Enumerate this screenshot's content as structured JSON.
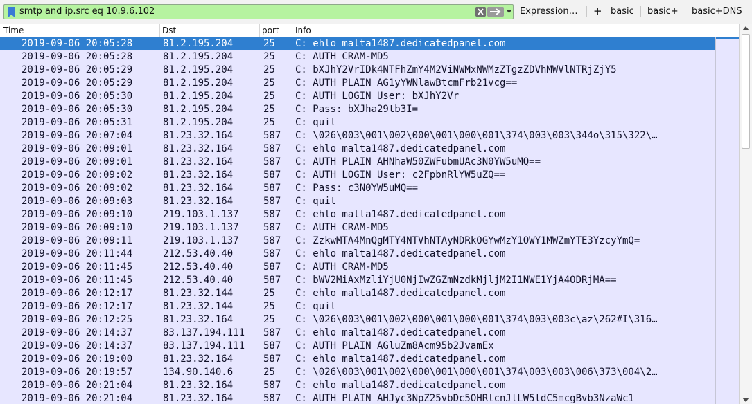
{
  "filter": {
    "value": "smtp and ip.src eq 10.9.6.102",
    "bookmark_icon": "bookmark-icon",
    "clear_icon": "clear-x-icon",
    "apply_icon": "apply-arrow-icon",
    "dropdown_icon": "chevron-down-icon",
    "background_color": "#b6f3a0"
  },
  "toolbar": {
    "expression_label": "Expression…",
    "add_label": "+",
    "buttons": [
      "basic",
      "basic+",
      "basic+DNS"
    ]
  },
  "columns": [
    "Time",
    "Dst",
    "port",
    "Info"
  ],
  "selected_color": "#2f7fd0",
  "row_color": "#e7e6ff",
  "rows": [
    {
      "time": "2019-09-06 20:05:28",
      "dst": "81.2.195.204",
      "port": "25",
      "info": "C: ehlo malta1487.dedicatedpanel.com",
      "selected": true,
      "conv": "start"
    },
    {
      "time": "2019-09-06 20:05:28",
      "dst": "81.2.195.204",
      "port": "25",
      "info": "C: AUTH CRAM-MD5",
      "conv": "mid"
    },
    {
      "time": "2019-09-06 20:05:29",
      "dst": "81.2.195.204",
      "port": "25",
      "info": "C: bXJhY2VrIDk4NTFhZmY4M2ViNWMxNWMzZTgzZDVhMWVlNTRjZjY5",
      "conv": "mid"
    },
    {
      "time": "2019-09-06 20:05:29",
      "dst": "81.2.195.204",
      "port": "25",
      "info": "C: AUTH PLAIN AG1yYWNlawBtcmFrb21vcg==",
      "conv": "mid"
    },
    {
      "time": "2019-09-06 20:05:30",
      "dst": "81.2.195.204",
      "port": "25",
      "info": "C: AUTH LOGIN User: bXJhY2Vr",
      "conv": "mid"
    },
    {
      "time": "2019-09-06 20:05:30",
      "dst": "81.2.195.204",
      "port": "25",
      "info": "C: Pass: bXJha29tb3I=",
      "conv": "mid"
    },
    {
      "time": "2019-09-06 20:05:31",
      "dst": "81.2.195.204",
      "port": "25",
      "info": "C: quit",
      "conv": "end"
    },
    {
      "time": "2019-09-06 20:07:04",
      "dst": "81.23.32.164",
      "port": "587",
      "info": "C: \\026\\003\\001\\002\\000\\001\\000\\001\\374\\003\\003\\344o\\315\\322\\…"
    },
    {
      "time": "2019-09-06 20:09:01",
      "dst": "81.23.32.164",
      "port": "587",
      "info": "C: ehlo malta1487.dedicatedpanel.com"
    },
    {
      "time": "2019-09-06 20:09:01",
      "dst": "81.23.32.164",
      "port": "587",
      "info": "C: AUTH PLAIN AHNhaW50ZWFubmUAc3N0YW5uMQ=="
    },
    {
      "time": "2019-09-06 20:09:02",
      "dst": "81.23.32.164",
      "port": "587",
      "info": "C: AUTH LOGIN User: c2FpbnRlYW5uZQ=="
    },
    {
      "time": "2019-09-06 20:09:02",
      "dst": "81.23.32.164",
      "port": "587",
      "info": "C: Pass: c3N0YW5uMQ=="
    },
    {
      "time": "2019-09-06 20:09:03",
      "dst": "81.23.32.164",
      "port": "587",
      "info": "C: quit"
    },
    {
      "time": "2019-09-06 20:09:10",
      "dst": "219.103.1.137",
      "port": "587",
      "info": "C: ehlo malta1487.dedicatedpanel.com"
    },
    {
      "time": "2019-09-06 20:09:10",
      "dst": "219.103.1.137",
      "port": "587",
      "info": "C: AUTH CRAM-MD5"
    },
    {
      "time": "2019-09-06 20:09:11",
      "dst": "219.103.1.137",
      "port": "587",
      "info": "C: ZzkwMTA4MnQgMTY4NTVhNTAyNDRkOGYwMzY1OWY1MWZmYTE3YzcyYmQ="
    },
    {
      "time": "2019-09-06 20:11:44",
      "dst": "212.53.40.40",
      "port": "587",
      "info": "C: ehlo malta1487.dedicatedpanel.com"
    },
    {
      "time": "2019-09-06 20:11:45",
      "dst": "212.53.40.40",
      "port": "587",
      "info": "C: AUTH CRAM-MD5"
    },
    {
      "time": "2019-09-06 20:11:45",
      "dst": "212.53.40.40",
      "port": "587",
      "info": "C: bWV2MiAxMzliYjU0NjIwZGZmNzdkMjljM2I1NWE1YjA4ODRjMA=="
    },
    {
      "time": "2019-09-06 20:12:17",
      "dst": "81.23.32.144",
      "port": "25",
      "info": "C: ehlo malta1487.dedicatedpanel.com"
    },
    {
      "time": "2019-09-06 20:12:17",
      "dst": "81.23.32.144",
      "port": "25",
      "info": "C: quit"
    },
    {
      "time": "2019-09-06 20:12:25",
      "dst": "81.23.32.164",
      "port": "25",
      "info": "C: \\026\\003\\001\\002\\000\\001\\000\\001\\374\\003\\003c\\az\\262#I\\316…"
    },
    {
      "time": "2019-09-06 20:14:37",
      "dst": "83.137.194.111",
      "port": "587",
      "info": "C: ehlo malta1487.dedicatedpanel.com"
    },
    {
      "time": "2019-09-06 20:14:37",
      "dst": "83.137.194.111",
      "port": "587",
      "info": "C: AUTH PLAIN AGluZm8Acm95b2JvamEx"
    },
    {
      "time": "2019-09-06 20:19:00",
      "dst": "81.23.32.164",
      "port": "587",
      "info": "C: ehlo malta1487.dedicatedpanel.com"
    },
    {
      "time": "2019-09-06 20:19:57",
      "dst": "134.90.140.6",
      "port": "25",
      "info": "C: \\026\\003\\001\\002\\000\\001\\000\\001\\374\\003\\003\\006\\373\\004\\2…"
    },
    {
      "time": "2019-09-06 20:21:04",
      "dst": "81.23.32.164",
      "port": "587",
      "info": "C: ehlo malta1487.dedicatedpanel.com"
    },
    {
      "time": "2019-09-06 20:21:04",
      "dst": "81.23.32.164",
      "port": "587",
      "info": "C: AUTH PLAIN AHJyc3NpZ25vbDc5OHRlcnJlLW5ldC5mcgBvb3NzaWc1"
    }
  ]
}
